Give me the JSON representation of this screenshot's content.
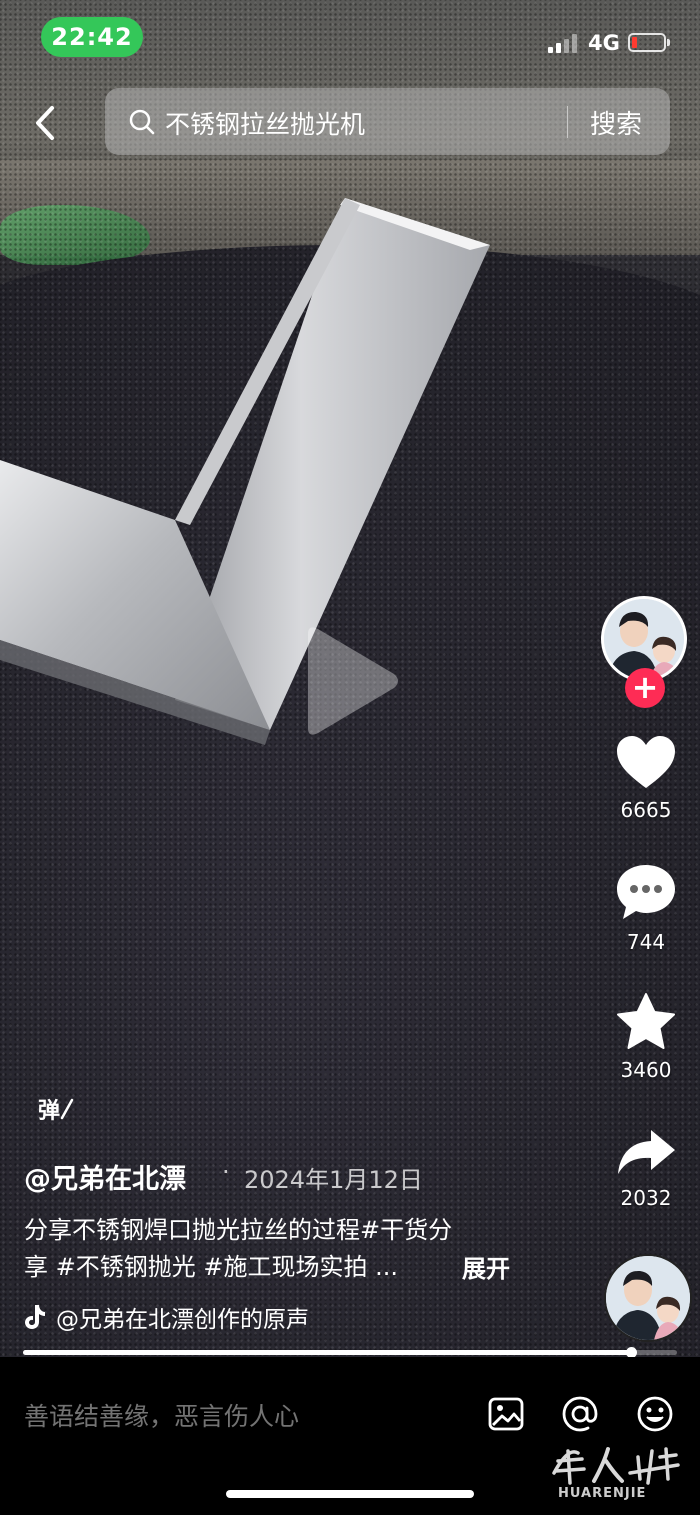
{
  "status": {
    "time": "22:42",
    "network": "4G"
  },
  "search": {
    "query": "不锈钢拉丝抛光机",
    "button": "搜索"
  },
  "actions": {
    "likes": "6665",
    "comments": "744",
    "favorites": "3460",
    "shares": "2032",
    "follow_symbol": "+"
  },
  "caption": {
    "danmu": "弹",
    "author": "@兄弟在北漂",
    "separator": "·",
    "date": "2024年1月12日",
    "description_line1": "分享不锈钢焊口抛光拉丝的过程#干货分",
    "description_line2": "享 #不锈钢抛光 #施工现场实拍 ...",
    "expand": "展开",
    "music": "@兄弟在北漂创作的原声"
  },
  "playback": {
    "progress": 0.93
  },
  "comment_bar": {
    "placeholder": "善语结善缘，恶言伤人心"
  },
  "watermark": {
    "text": "HUARENJIE"
  },
  "colors": {
    "accent": "#fe2c55",
    "time_pill": "#34c759",
    "battery_low": "#ff3b30"
  }
}
